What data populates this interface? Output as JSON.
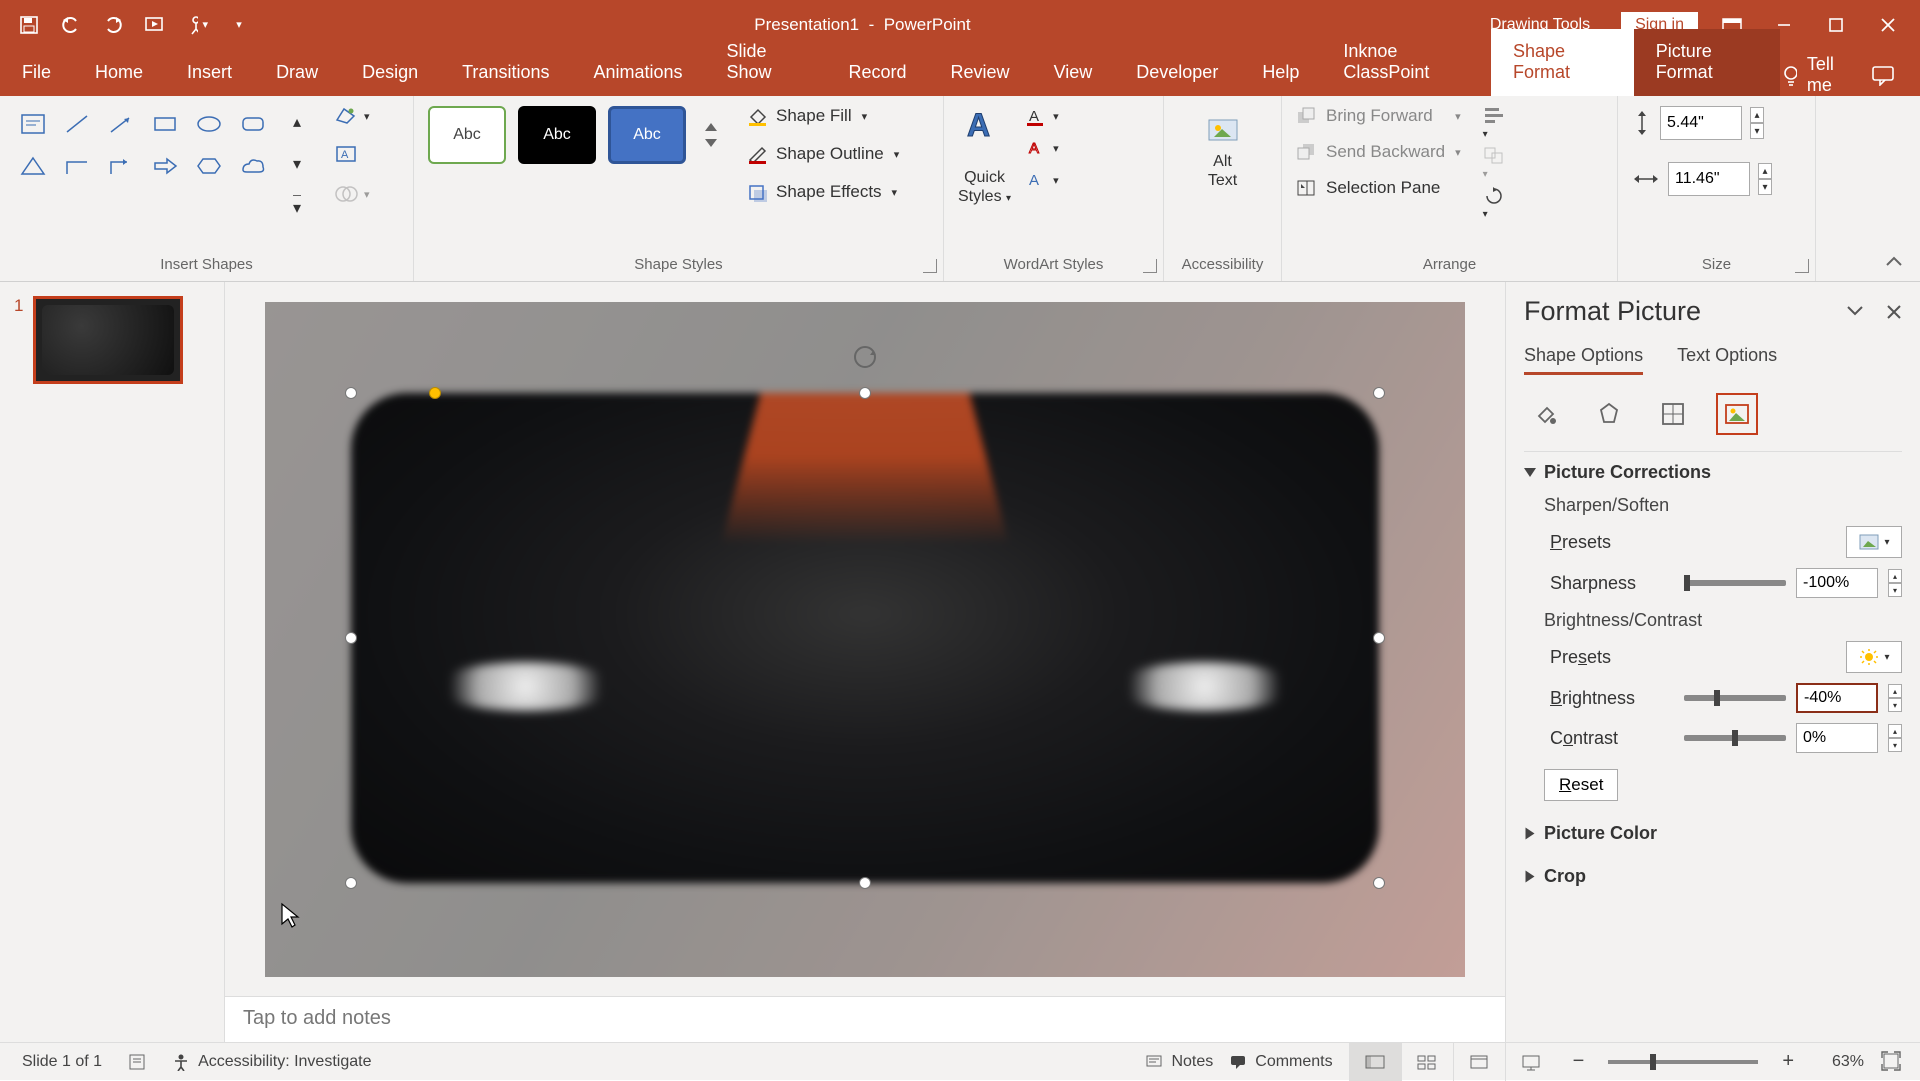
{
  "title": {
    "doc": "Presentation1",
    "app": "PowerPoint",
    "drawing_tools": "Drawing Tools",
    "sign_in": "Sign in"
  },
  "tabs": {
    "file": "File",
    "home": "Home",
    "insert": "Insert",
    "draw": "Draw",
    "design": "Design",
    "transitions": "Transitions",
    "animations": "Animations",
    "slideshow": "Slide Show",
    "record": "Record",
    "review": "Review",
    "view": "View",
    "developer": "Developer",
    "help": "Help",
    "classpoint": "Inknoe ClassPoint",
    "shape_format": "Shape Format",
    "picture_format": "Picture Format",
    "tell_me": "Tell me"
  },
  "groups": {
    "insert_shapes": "Insert Shapes",
    "shape_styles": "Shape Styles",
    "wordart_styles": "WordArt Styles",
    "accessibility": "Accessibility",
    "arrange": "Arrange",
    "size": "Size"
  },
  "shape_styles": {
    "abc": "Abc",
    "fill": "Shape Fill",
    "outline": "Shape Outline",
    "effects": "Shape Effects"
  },
  "wordart": {
    "quick_styles_l1": "Quick",
    "quick_styles_l2": "Styles"
  },
  "accessibility": {
    "alt_text_l1": "Alt",
    "alt_text_l2": "Text"
  },
  "arrange": {
    "bring_forward": "Bring Forward",
    "send_backward": "Send Backward",
    "selection_pane": "Selection Pane"
  },
  "size": {
    "height": "5.44\"",
    "width": "11.46\""
  },
  "thumb": {
    "num": "1"
  },
  "notes_placeholder": "Tap to add notes",
  "fmt": {
    "title": "Format Picture",
    "tab_shape": "Shape Options",
    "tab_text": "Text Options",
    "sec_corrections": "Picture Corrections",
    "sharpen_soften": "Sharpen/Soften",
    "presets": "Presets",
    "sharpness": "Sharpness",
    "sharpness_val": "-100%",
    "brightness_contrast": "Brightness/Contrast",
    "brightness": "Brightness",
    "brightness_val": "-40%",
    "contrast": "Contrast",
    "contrast_val": "0%",
    "reset": "Reset",
    "sec_color": "Picture Color",
    "sec_crop": "Crop"
  },
  "status": {
    "slide": "Slide 1 of 1",
    "accessibility": "Accessibility: Investigate",
    "notes": "Notes",
    "comments": "Comments",
    "zoom": "63%"
  }
}
